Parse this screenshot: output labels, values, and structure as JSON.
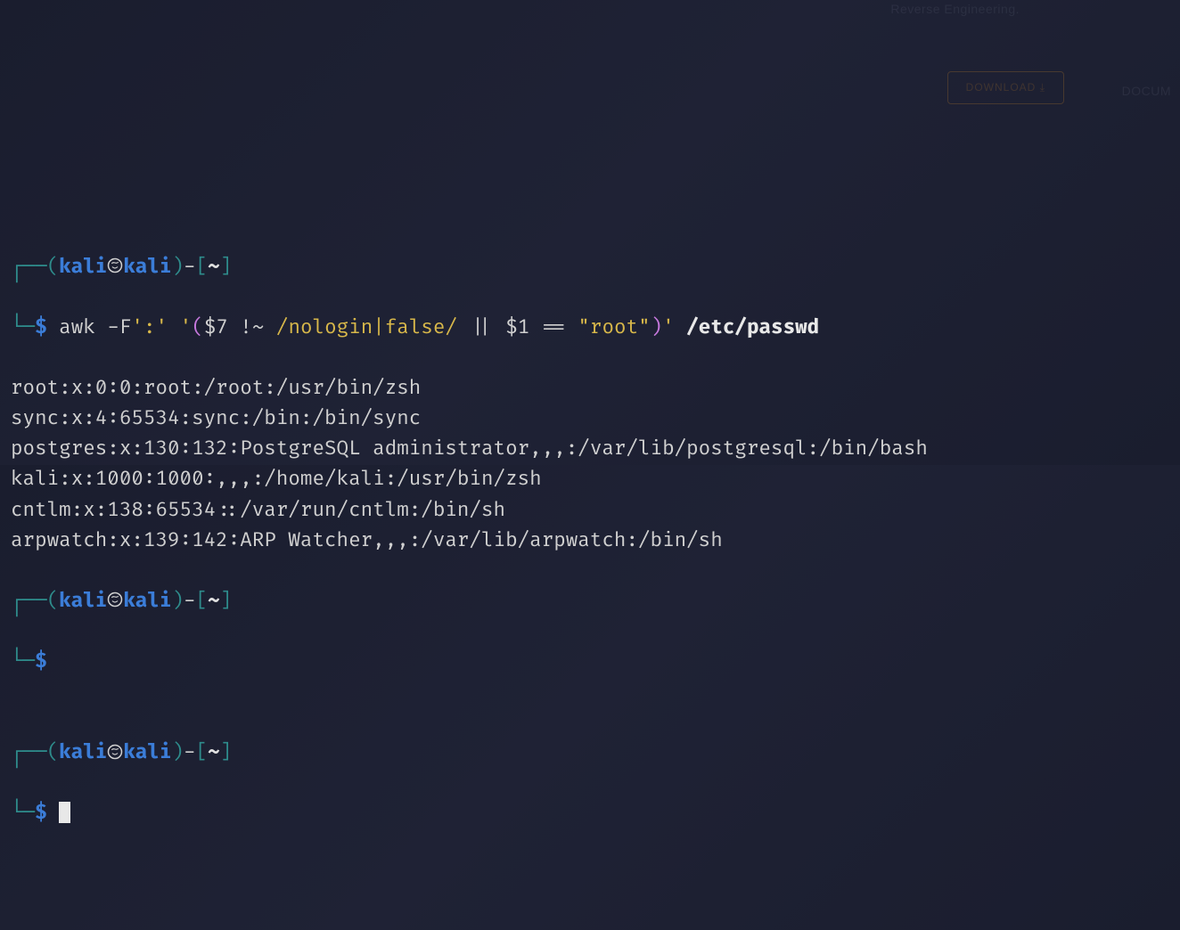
{
  "bg_text": {
    "reverse": "Reverse Engineering.",
    "download": "DOWNLOAD",
    "docum": "DOCUM"
  },
  "prompts": [
    {
      "user": "kali",
      "host": "kali",
      "path": "~",
      "command": {
        "cmd": "awk",
        "flag": "-F",
        "delim": "':'",
        "open_q": "'",
        "lparen": "(",
        "var1": "$7",
        "op1": " !~ ",
        "regex": "/nologin|false/",
        "pipe": " || ",
        "var2": "$1",
        "eq": " == ",
        "rootstr": "\"root\"",
        "rparen": ")",
        "close_q": "'",
        "file": "/etc/passwd"
      }
    },
    {
      "user": "kali",
      "host": "kali",
      "path": "~",
      "command": null
    },
    {
      "user": "kali",
      "host": "kali",
      "path": "~",
      "command": null,
      "cursor": true
    }
  ],
  "output": [
    "root:x:0:0:root:/root:/usr/bin/zsh",
    "sync:x:4:65534:sync:/bin:/bin/sync",
    "postgres:x:130:132:PostgreSQL administrator,,,:/var/lib/postgresql:/bin/bash",
    "kali:x:1000:1000:,,,:/home/kali:/usr/bin/zsh",
    "cntlm:x:138:65534::/var/run/cntlm:/bin/sh",
    "arpwatch:x:139:142:ARP Watcher,,,:/var/lib/arpwatch:/bin/sh"
  ]
}
